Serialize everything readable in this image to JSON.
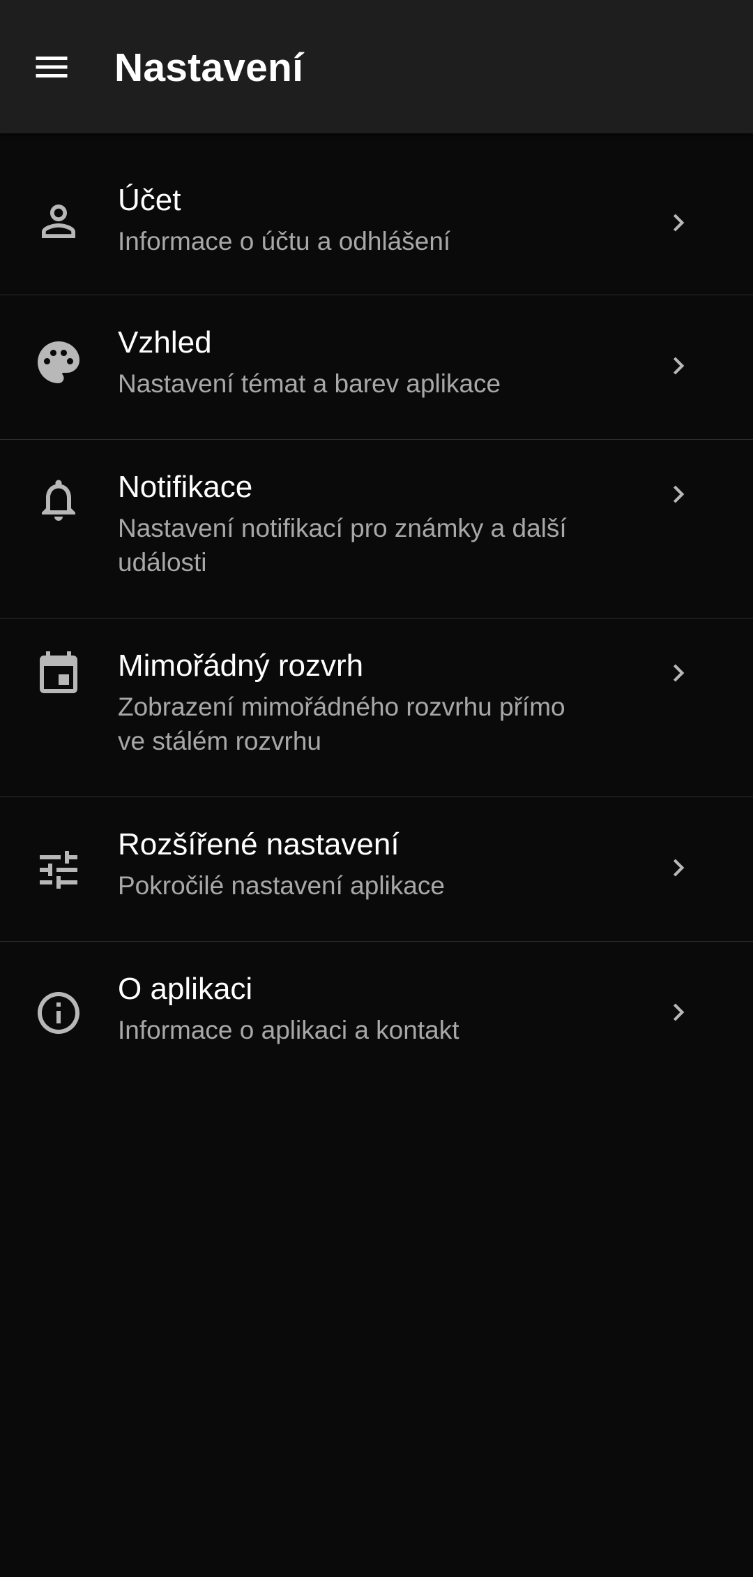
{
  "appbar": {
    "title": "Nastavení",
    "menu_icon": "menu-icon"
  },
  "settings": {
    "items": [
      {
        "icon": "person-icon",
        "title": "Účet",
        "subtitle": "Informace o účtu a odhlášení"
      },
      {
        "icon": "palette-icon",
        "title": "Vzhled",
        "subtitle": "Nastavení témat a barev aplikace"
      },
      {
        "icon": "bell-icon",
        "title": "Notifikace",
        "subtitle": "Nastavení notifikací pro známky a další události"
      },
      {
        "icon": "calendar-icon",
        "title": "Mimořádný rozvrh",
        "subtitle": "Zobrazení mimořádného rozvrhu přímo ve stálém rozvrhu"
      },
      {
        "icon": "tune-icon",
        "title": "Rozšířené nastavení",
        "subtitle": "Pokročilé nastavení aplikace"
      },
      {
        "icon": "info-icon",
        "title": "O aplikaci",
        "subtitle": "Informace o aplikaci a kontakt"
      }
    ],
    "chevron_icon": "chevron-right-icon"
  },
  "colors": {
    "appbar_bg": "#1e1e1e",
    "page_bg": "#0a0a0a",
    "primary_text": "#ffffff",
    "secondary_text": "#a8a8a8",
    "icon_color": "#b8b8b8",
    "divider": "#2e2e2e"
  }
}
